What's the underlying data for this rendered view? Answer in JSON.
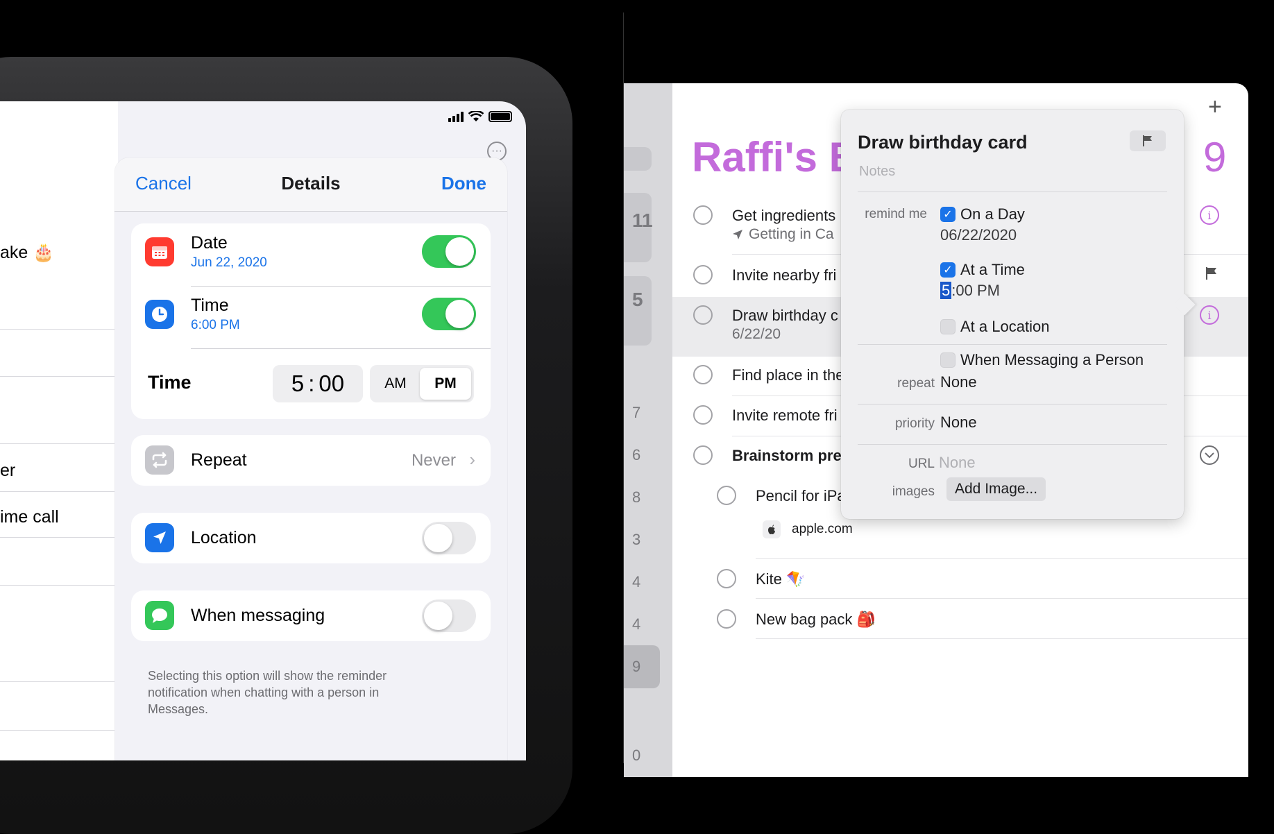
{
  "ipad": {
    "background_list": {
      "items": [
        "ake 🎂",
        "er",
        "ime call"
      ]
    },
    "details_sheet": {
      "nav": {
        "cancel": "Cancel",
        "title": "Details",
        "done": "Done"
      },
      "date": {
        "label": "Date",
        "value": "Jun 22, 2020",
        "enabled": true
      },
      "time": {
        "label": "Time",
        "value": "6:00 PM",
        "enabled": true
      },
      "time_picker": {
        "label": "Time",
        "hour": "5",
        "minute": "00",
        "am": "AM",
        "pm": "PM",
        "selected": "PM"
      },
      "repeat": {
        "label": "Repeat",
        "value": "Never"
      },
      "location": {
        "label": "Location",
        "enabled": false
      },
      "messaging": {
        "label": "When messaging",
        "enabled": false,
        "footnote": "Selecting this option will show the reminder notification when chatting with a person in Messages."
      }
    }
  },
  "mac": {
    "sidebar_counts": [
      "11",
      "5",
      "7",
      "6",
      "8",
      "3",
      "4",
      "4",
      "9",
      "0"
    ],
    "list": {
      "title": "Raffi's B",
      "count": "9",
      "items": [
        {
          "title": "Get ingredients",
          "sub": "Getting in Ca"
        },
        {
          "title": "Invite nearby fri"
        },
        {
          "title": "Draw birthday c",
          "sub": "6/22/20"
        },
        {
          "title": "Find place in the"
        },
        {
          "title": "Invite remote fri"
        },
        {
          "title": "Brainstorm pres"
        },
        {
          "title": "Pencil for iPa",
          "link": "apple.com"
        },
        {
          "title": "Kite 🪁"
        },
        {
          "title": "New bag pack 🎒"
        }
      ]
    },
    "popover": {
      "title": "Draw birthday card",
      "notes_placeholder": "Notes",
      "remind_me_label": "remind me",
      "on_a_day": {
        "label": "On a Day",
        "value": "06/22/2020",
        "checked": true
      },
      "at_a_time": {
        "label": "At a Time",
        "hour": "5",
        "rest": ":00 PM",
        "checked": true
      },
      "at_a_location": {
        "label": "At a Location",
        "checked": false
      },
      "when_messaging": {
        "label": "When Messaging a Person",
        "checked": false
      },
      "repeat": {
        "label": "repeat",
        "value": "None"
      },
      "priority": {
        "label": "priority",
        "value": "None"
      },
      "url": {
        "label": "URL",
        "placeholder": "None"
      },
      "images": {
        "label": "images",
        "button": "Add Image..."
      }
    }
  },
  "colors": {
    "accent_blue": "#1a73e8",
    "toggle_green": "#34c759",
    "list_purple": "#c36bdb"
  }
}
